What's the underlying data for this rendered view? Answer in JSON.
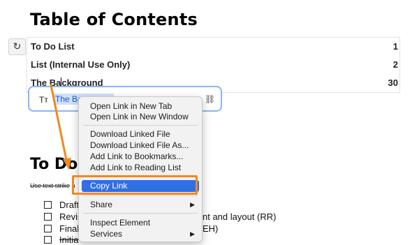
{
  "document": {
    "toc_title": "Table of Contents",
    "toc_entries": [
      {
        "label": "To Do List",
        "page": "1"
      },
      {
        "label": "List (Internal Use Only)",
        "page": "2"
      },
      {
        "label_before_caret": "The Ba",
        "label_after_caret": "ckground",
        "page": "30"
      }
    ],
    "section_title": "To Do",
    "note_strike": "Use text strike",
    "note_rest": " a",
    "todo_items": [
      {
        "text": "Draft",
        "strike": false
      },
      {
        "text": "Revis",
        "strike": false
      },
      {
        "text": "Final",
        "strike": false
      },
      {
        "text": "Initia",
        "strike": true
      }
    ],
    "todo_right_texts": [
      "nt and layout (RR)",
      "EH)"
    ]
  },
  "refresh_icon": "↻",
  "link_editor": {
    "format_icon": "Tт",
    "link_text": "The Ba",
    "unlink_icon": "⛓"
  },
  "context_menu": {
    "items": [
      {
        "label": "Open Link in New Tab"
      },
      {
        "label": "Open Link in New Window"
      },
      {
        "label": "Download Linked File"
      },
      {
        "label": "Download Linked File As..."
      },
      {
        "label": "Add Link to Bookmarks..."
      },
      {
        "label": "Add Link to Reading List"
      },
      {
        "label": "Copy Link",
        "selected": true
      },
      {
        "label": "Share",
        "submenu": true
      },
      {
        "label": "Inspect Element"
      },
      {
        "label": "Services",
        "submenu": true
      }
    ],
    "submenu_arrow": "▶"
  },
  "colors": {
    "selection_blue": "#2f6fe4",
    "annotation_orange": "#f0891d",
    "editor_border": "#8ab4f8"
  }
}
